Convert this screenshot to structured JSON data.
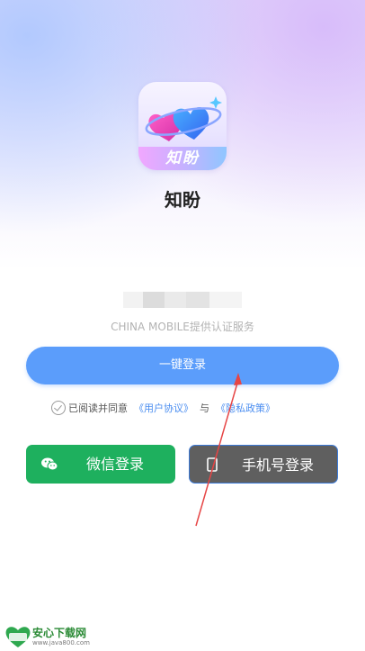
{
  "app": {
    "icon_label": "知盼",
    "name": "知盼"
  },
  "auth": {
    "masked_phone_suffix": "...0  1",
    "carrier_notice": "CHINA MOBILE提供认证服务",
    "one_click_login_label": "一键登录"
  },
  "agreement": {
    "prefix": "已阅读并同意",
    "user_agreement_link": "《用户协议》",
    "and_text": "与",
    "privacy_policy_link": "《隐私政策》"
  },
  "alt_logins": {
    "wechat_label": "微信登录",
    "phone_label": "手机号登录"
  },
  "watermark": {
    "name": "安心下载网",
    "url": "www.java800.com"
  },
  "colors": {
    "primary_blue": "#5b9dfb",
    "wechat_green": "#1eb05e",
    "phone_btn_gray": "#5f5f5f"
  }
}
